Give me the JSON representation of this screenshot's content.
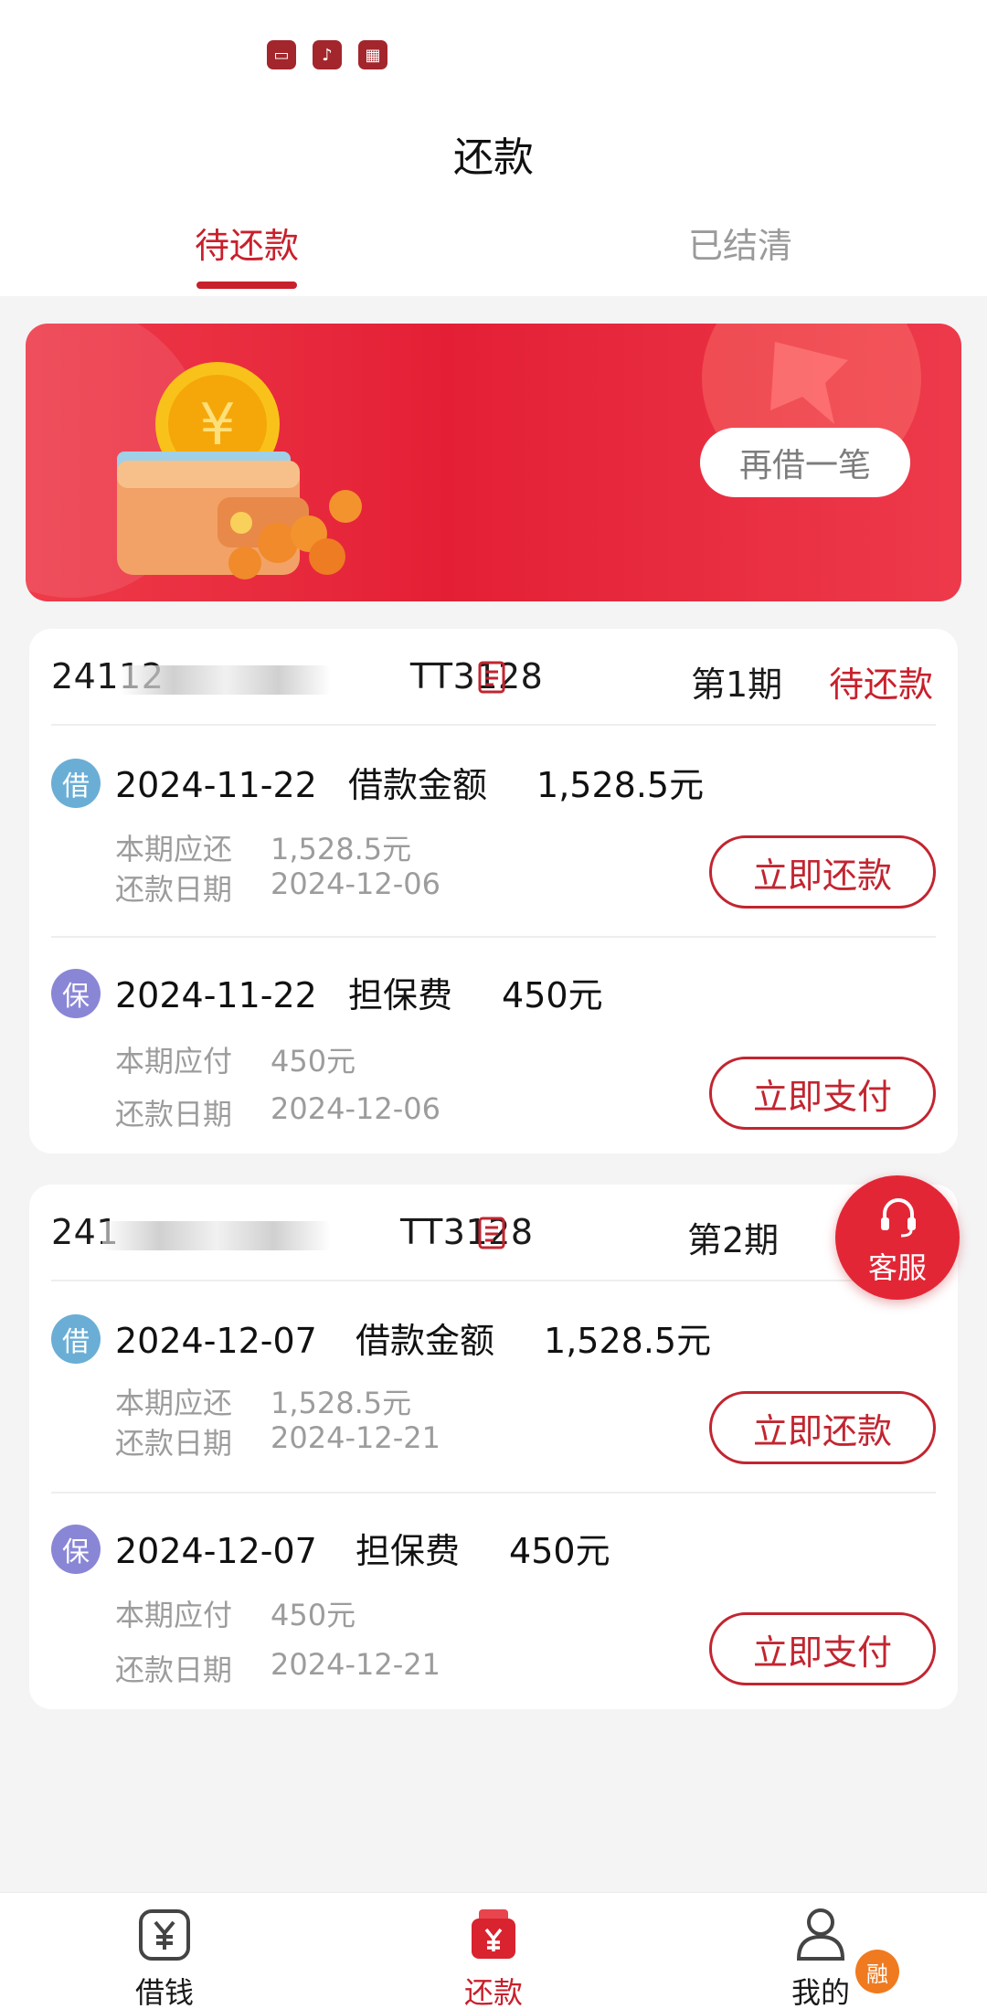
{
  "header": {
    "status_icons": [
      "message-icon",
      "tiktok-icon",
      "grid-icon"
    ],
    "title": "还款"
  },
  "tabs": [
    {
      "label": "待还款",
      "active": true
    },
    {
      "label": "已结清",
      "active": false
    }
  ],
  "banner": {
    "button_label": "再借一笔"
  },
  "loans": [
    {
      "order_id": "24112       TT3128",
      "period": "第1期",
      "status": "待还款",
      "items": [
        {
          "badge": "借",
          "date": "2024-11-22",
          "label": "借款金额",
          "amount": "1,528.5元",
          "due_label": "本期应还",
          "due_value": "1,528.5元",
          "date_label": "还款日期",
          "date_value": "2024-12-06",
          "button": "立即还款"
        },
        {
          "badge": "保",
          "date": "2024-11-22",
          "label": "担保费",
          "amount": "450元",
          "due_label": "本期应付",
          "due_value": "450元",
          "date_label": "还款日期",
          "date_value": "2024-12-06",
          "button": "立即支付"
        }
      ]
    },
    {
      "order_id": "241        TT3128",
      "period": "第2期",
      "status": "",
      "items": [
        {
          "badge": "借",
          "date": "2024-12-07",
          "label": "借款金额",
          "amount": "1,528.5元",
          "due_label": "本期应还",
          "due_value": "1,528.5元",
          "date_label": "还款日期",
          "date_value": "2024-12-21",
          "button": "立即还款"
        },
        {
          "badge": "保",
          "date": "2024-12-07",
          "label": "担保费",
          "amount": "450元",
          "due_label": "本期应付",
          "due_value": "450元",
          "date_label": "还款日期",
          "date_value": "2024-12-21",
          "button": "立即支付"
        }
      ]
    }
  ],
  "service": {
    "label": "客服"
  },
  "bottom_nav": [
    {
      "label": "借钱",
      "icon": "yuan-box-icon",
      "active": false
    },
    {
      "label": "还款",
      "icon": "wallet-yuan-icon",
      "active": true
    },
    {
      "label": "我的",
      "icon": "user-icon",
      "active": false,
      "badge": "融"
    }
  ],
  "colors": {
    "accent": "#c8202c",
    "banner": "#e41f35",
    "borrow_badge": "#6aaed6",
    "guarantee_badge": "#8a86d6"
  }
}
